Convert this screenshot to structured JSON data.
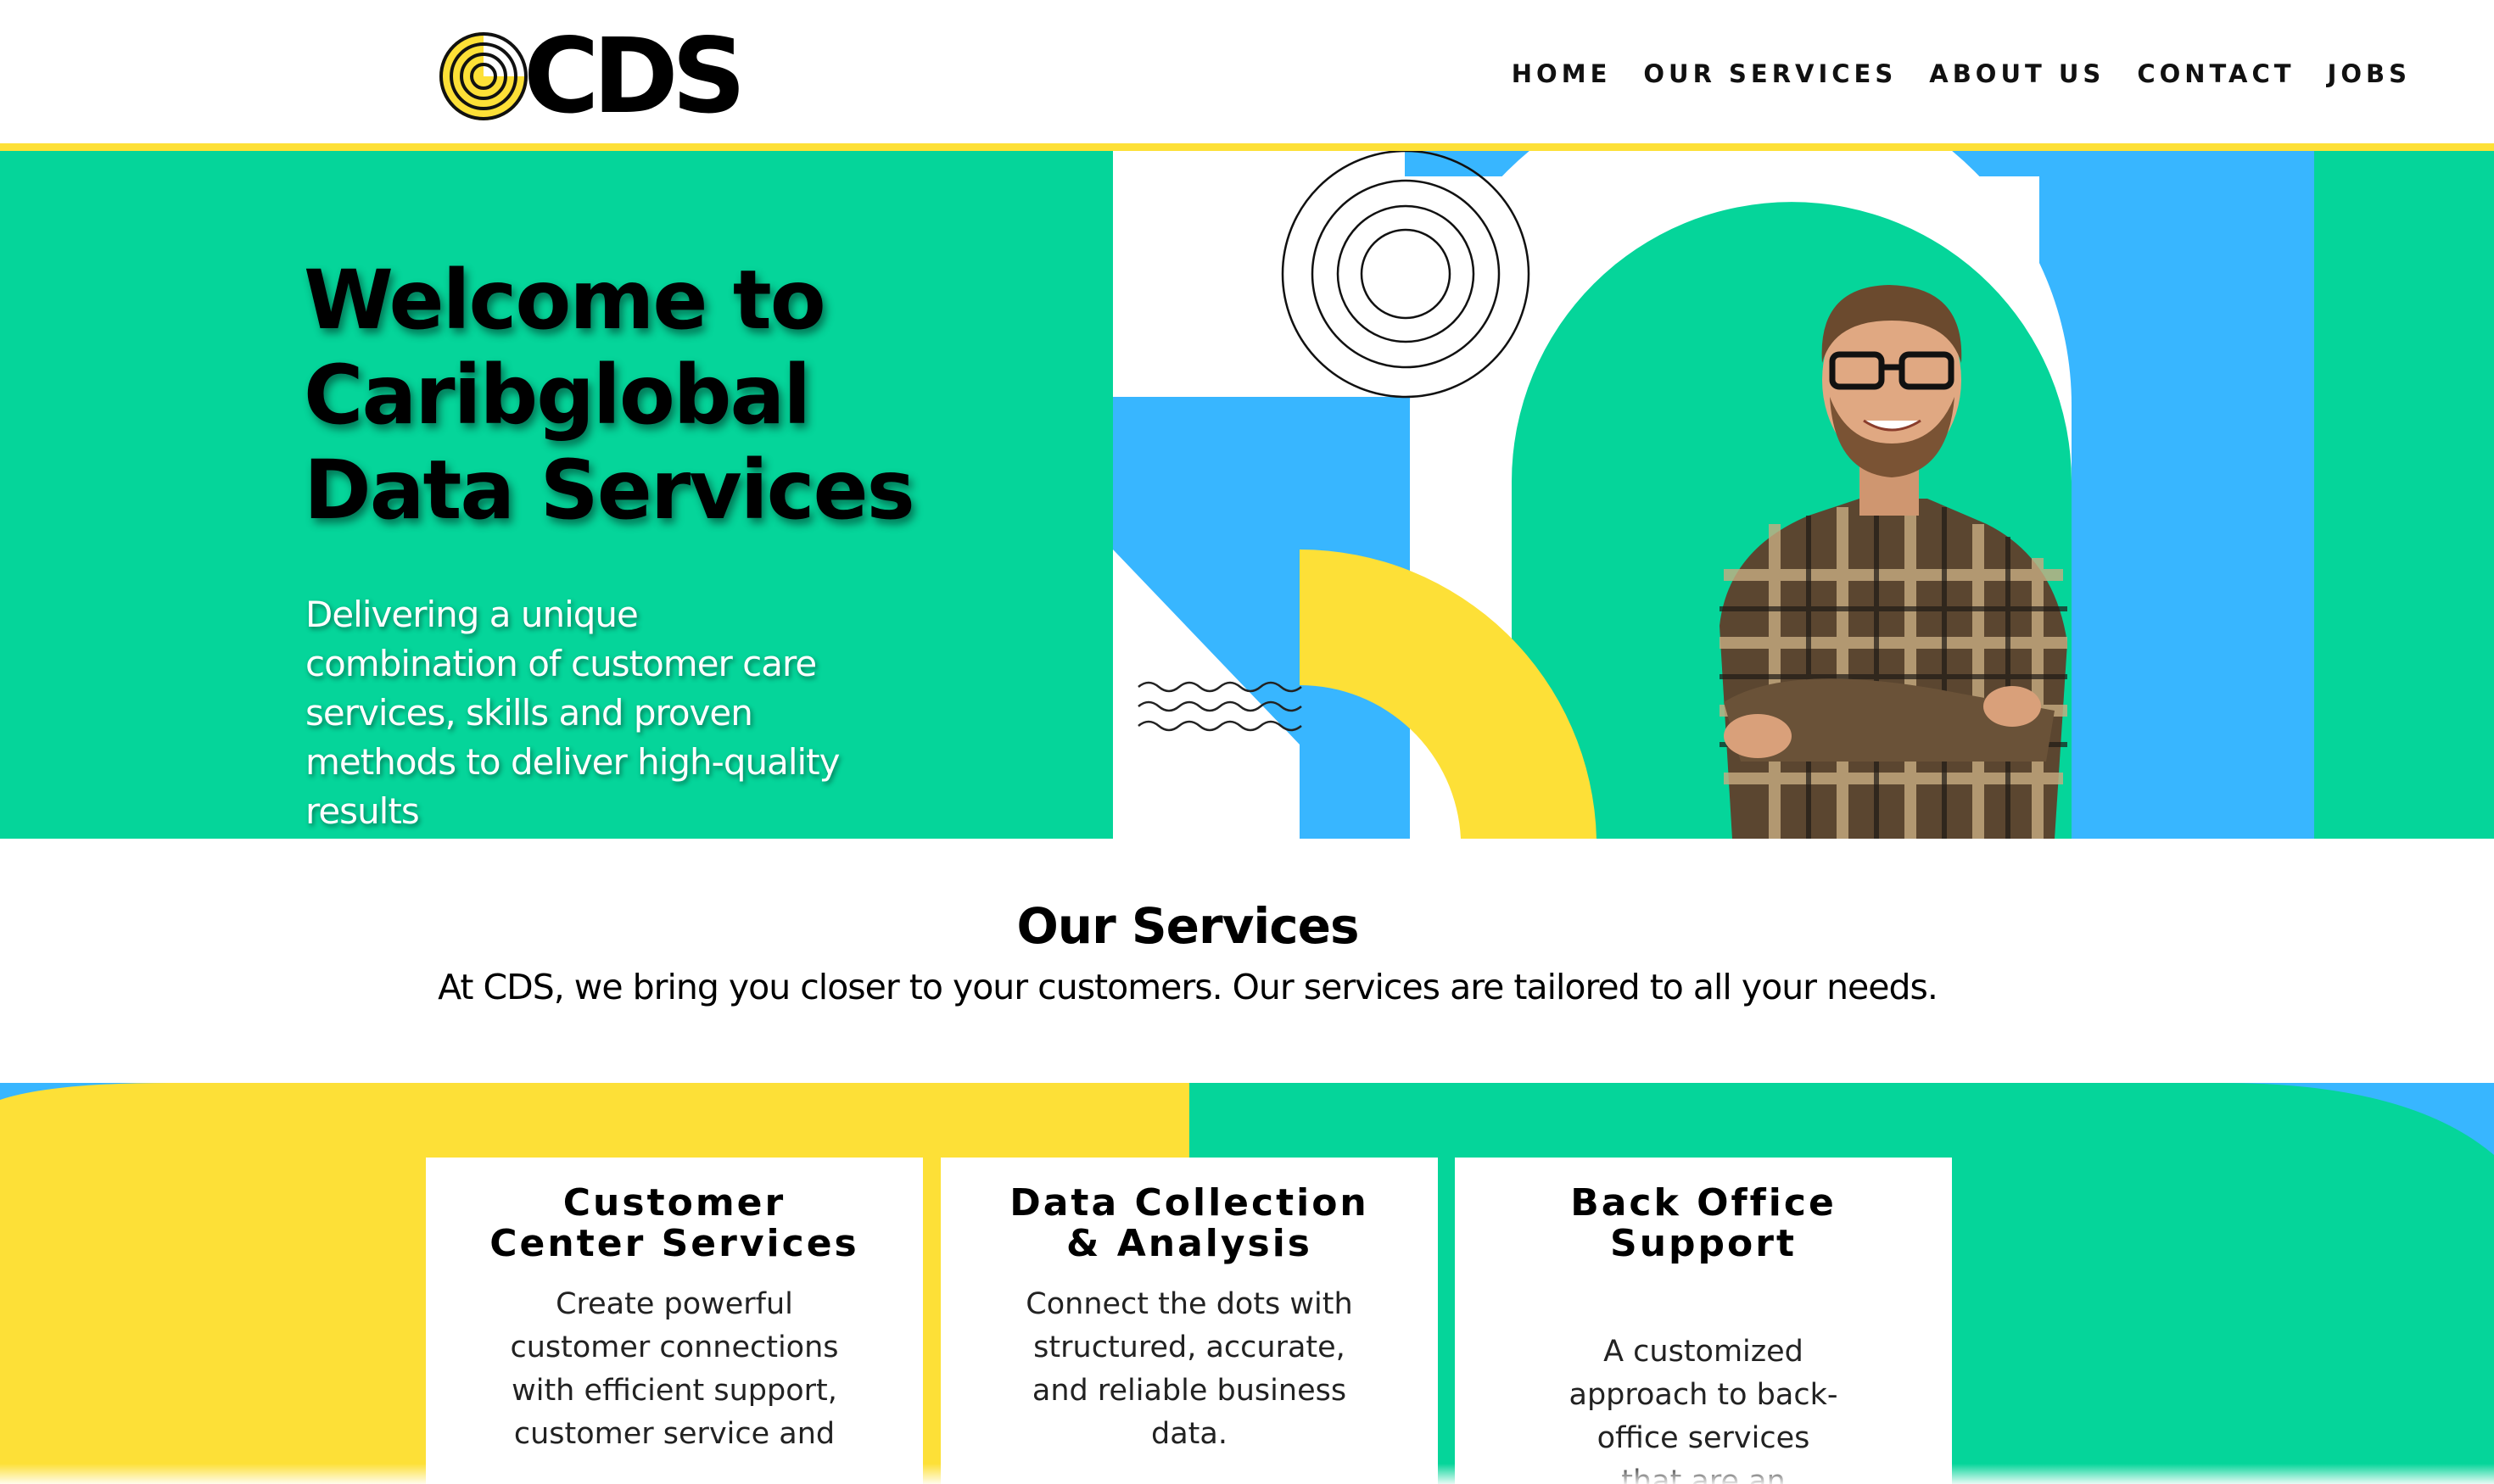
{
  "brand": {
    "name": "CDS",
    "colors": {
      "green": "#05d59a",
      "yellow": "#fde037",
      "blue": "#38b6ff",
      "black": "#000000"
    }
  },
  "nav": {
    "items": [
      {
        "label": "HOME"
      },
      {
        "label": "OUR SERVICES"
      },
      {
        "label": "ABOUT US"
      },
      {
        "label": "CONTACT"
      },
      {
        "label": "JOBS"
      }
    ]
  },
  "hero": {
    "title": "Welcome to Caribglobal Data Services",
    "subtitle": "Delivering a unique combination of customer care services, skills and proven methods to deliver high-quality results"
  },
  "services": {
    "heading": "Our Services",
    "tagline": "At CDS, we bring you closer to your customers. Our services are tailored to all your needs.",
    "cards": [
      {
        "title": "Customer Center Services",
        "text": "Create powerful customer connections with efficient support, customer service and"
      },
      {
        "title": "Data Collection & Analysis",
        "text": "Connect the dots with structured, accurate, and reliable business data."
      },
      {
        "title": "Back Office Support",
        "text": "A customized approach to back-office services that are an extension of"
      }
    ]
  },
  "icons": [
    "cds-logo-icon",
    "concentric-circles-icon",
    "wavy-lines-icon"
  ]
}
